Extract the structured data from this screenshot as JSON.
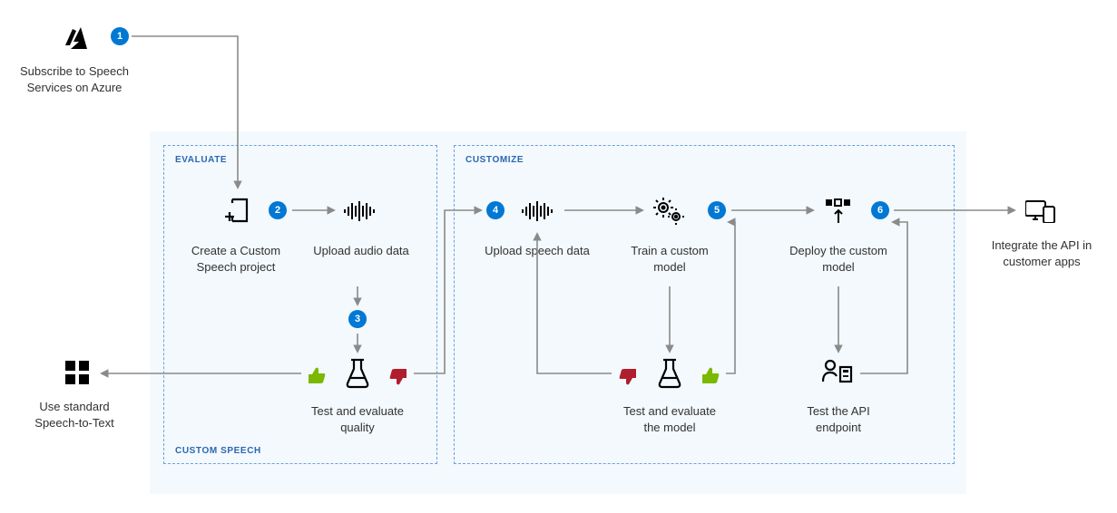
{
  "diagram": {
    "externalLeft": {
      "subscribe": "Subscribe to Speech Services on Azure",
      "useStandard": "Use standard Speech-to-Text"
    },
    "externalRight": {
      "integrate": "Integrate the API in customer apps"
    },
    "panels": {
      "outerTitle": "CUSTOM SPEECH",
      "evaluateTitle": "EVALUATE",
      "customizeTitle": "CUSTOMIZE"
    },
    "steps": {
      "s1": "1",
      "s2": "2",
      "s3": "3",
      "s4": "4",
      "s5": "5",
      "s6": "6"
    },
    "labels": {
      "createProject": "Create a Custom Speech project",
      "uploadAudio": "Upload audio data",
      "testQuality": "Test and evaluate quality",
      "uploadSpeech": "Upload speech data",
      "trainModel": "Train a custom model",
      "deployModel": "Deploy the custom model",
      "testModel": "Test and evaluate the model",
      "testEndpoint": "Test the API endpoint"
    }
  }
}
